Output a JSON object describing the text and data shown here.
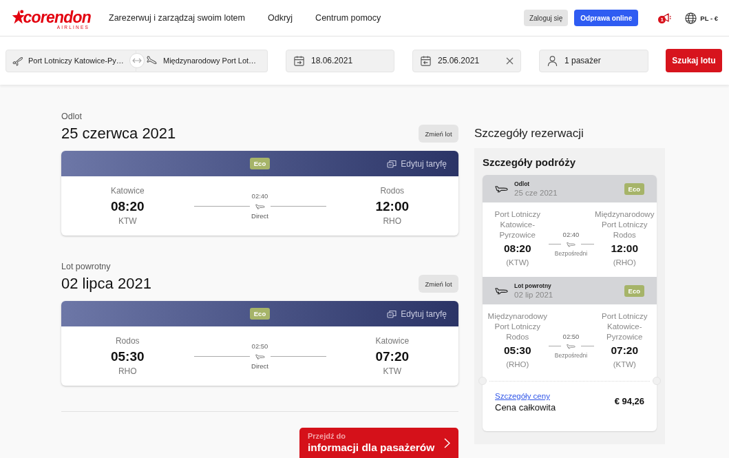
{
  "header": {
    "logo": {
      "name": "corendon",
      "tagline": "AIRLINES"
    },
    "nav": [
      "Zarezerwuj i zarządzaj swoim lotem",
      "Odkryj",
      "Centrum pomocy"
    ],
    "login_button": "Zaloguj się",
    "checkin_button": "Odprawa online",
    "notification_count": "1",
    "locale": "PL - €"
  },
  "search": {
    "origin": "Port Lotniczy Katowice-Py…",
    "destination": "Międzynarodowy Port Lot…",
    "depart_date": "18.06.2021",
    "return_date": "25.06.2021",
    "passengers": "1 pasażer",
    "search_button": "Szukaj lotu"
  },
  "flights": [
    {
      "label": "Odlot",
      "date": "25 czerwca 2021",
      "change_button": "Zmień lot",
      "fare": "Eco",
      "edit_fare": "Edytuj taryfę",
      "from_city": "Katowice",
      "dep_time": "08:20",
      "from_code": "KTW",
      "duration": "02:40",
      "stops": "Direct",
      "to_city": "Rodos",
      "arr_time": "12:00",
      "to_code": "RHO"
    },
    {
      "label": "Lot powrotny",
      "date": "02 lipca 2021",
      "change_button": "Zmień lot",
      "fare": "Eco",
      "edit_fare": "Edytuj taryfę",
      "from_city": "Rodos",
      "dep_time": "05:30",
      "from_code": "RHO",
      "duration": "02:50",
      "stops": "Direct",
      "to_city": "Katowice",
      "arr_time": "07:20",
      "to_code": "KTW"
    }
  ],
  "continue_button": {
    "caption": "Przejdź do",
    "label": "informacji dla pasażerów"
  },
  "summary": {
    "title": "Szczegóły rezerwacji",
    "panel_title": "Szczegóły podróży",
    "segments": [
      {
        "label": "Odlot",
        "date": "25 cze 2021",
        "fare": "Eco",
        "from_airport": "Port Lotniczy Katowice-Pyrzowice",
        "dep_time": "08:20",
        "from_code": "(KTW)",
        "duration": "02:40",
        "stops": "Bezpośredni",
        "to_airport": "Międzynarodowy Port Lotniczy Rodos",
        "arr_time": "12:00",
        "to_code": "(RHO)"
      },
      {
        "label": "Lot powrotny",
        "date": "02 lip 2021",
        "fare": "Eco",
        "from_airport": "Międzynarodowy Port Lotniczy Rodos",
        "dep_time": "05:30",
        "from_code": "(RHO)",
        "duration": "02:50",
        "stops": "Bezpośredni",
        "to_airport": "Port Lotniczy Katowice-Pyrzowice",
        "arr_time": "07:20",
        "to_code": "(KTW)"
      }
    ],
    "price_link": "Szczegóły ceny",
    "total_label": "Cena całkowita",
    "total": "€ 94,26"
  }
}
